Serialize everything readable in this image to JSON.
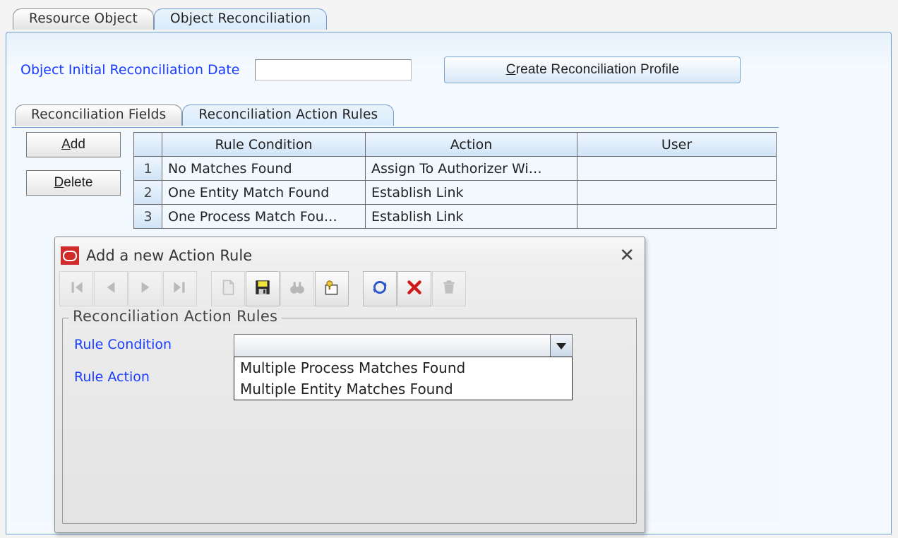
{
  "outer_tabs": {
    "resource_object": "Resource Object",
    "object_reconciliation": "Object Reconciliation"
  },
  "top_row": {
    "label": "Object Initial Reconciliation Date",
    "date_value": "",
    "create_profile_pre": "C",
    "create_profile_post": "reate Reconciliation Profile"
  },
  "inner_tabs": {
    "fields": "Reconciliation Fields",
    "action_rules": "Reconciliation Action Rules"
  },
  "side_buttons": {
    "add_pre": "A",
    "add_post": "dd",
    "delete_pre": "D",
    "delete_post": "elete"
  },
  "table": {
    "headers": {
      "rule_condition": "Rule Condition",
      "action": "Action",
      "user": "User"
    },
    "rows": [
      {
        "n": "1",
        "rule_condition": "No Matches Found",
        "action": "Assign To Authorizer Wi…",
        "user": ""
      },
      {
        "n": "2",
        "rule_condition": "One Entity Match Found",
        "action": "Establish Link",
        "user": ""
      },
      {
        "n": "3",
        "rule_condition": "One Process Match Fou…",
        "action": "Establish Link",
        "user": ""
      }
    ]
  },
  "dialog": {
    "title": "Add a new Action Rule",
    "group_legend": "Reconciliation Action Rules",
    "labels": {
      "rule_condition": "Rule Condition",
      "rule_action": "Rule Action"
    },
    "rule_condition_value": "",
    "rule_condition_options": [
      "Multiple Process Matches Found",
      "Multiple Entity Matches Found"
    ]
  }
}
